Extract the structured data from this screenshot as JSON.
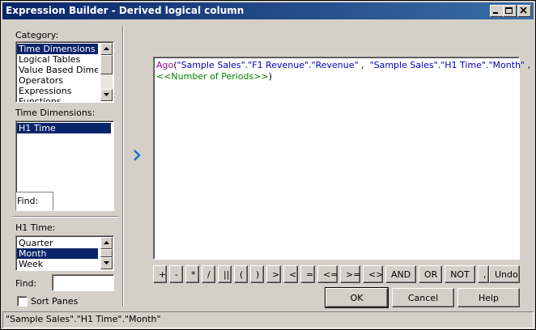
{
  "window": {
    "title": "Expression Builder - Derived logical column"
  },
  "category": {
    "label": "Category:",
    "items": [
      "Time Dimensions",
      "Logical Tables",
      "Value Based Dimensions",
      "Operators",
      "Expressions",
      "Functions"
    ],
    "selected": "Time Dimensions"
  },
  "time_dimensions": {
    "label": "Time Dimensions:",
    "items": [
      "H1 Time"
    ],
    "selected": "H1 Time",
    "find_label": "Find:"
  },
  "h1_time": {
    "label": "H1 Time:",
    "items": [
      "Quarter",
      "Month",
      "Week"
    ],
    "selected": "Month",
    "find_label": "Find:"
  },
  "sort_panes": {
    "label": "Sort Panes",
    "checked": false
  },
  "expression": {
    "function": "Ago",
    "open_paren": "(",
    "arg1": "\"Sample Sales\".\"F1 Revenue\".\"Revenue\"",
    "sep1": " ,  ",
    "arg2": "\"Sample Sales\".\"H1 Time\".\"Month\"",
    "sep2": " ,",
    "placeholder": "<<Number of Periods>>",
    "close_paren": ")"
  },
  "operators": [
    "+",
    "-",
    "*",
    "/",
    "||",
    "(",
    ")",
    ">",
    "<",
    "=",
    "<=",
    ">=",
    "<>",
    "AND",
    "OR",
    "NOT",
    ","
  ],
  "buttons": {
    "undo": "Undo",
    "ok": "OK",
    "cancel": "Cancel",
    "help": "Help"
  },
  "status_text": "\"Sample Sales\".\"H1 Time\".\"Month\"",
  "icons": {
    "insert": "chevron-right-icon",
    "minimize": "minimize-icon",
    "maximize": "maximize-icon",
    "close": "close-icon"
  },
  "colors": {
    "titlebar": "#0a246a",
    "selection": "#0a246a",
    "function": "#a000a0",
    "string": "#0000c0",
    "placeholder": "#008000",
    "insert_arrow": "#1c6fd0"
  }
}
